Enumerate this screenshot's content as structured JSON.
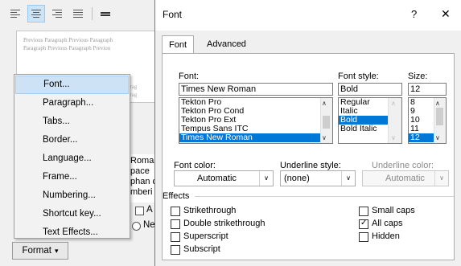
{
  "background_dialog": {
    "preview_text_lines": [
      "Previous Paragraph Previous Paragraph",
      "Paragraph Previous Paragraph Previou"
    ],
    "preview_body_lines": [
      "g Parag",
      "g Parag"
    ],
    "behind_text_lines": [
      "Roman",
      "pace",
      "phan c",
      "mberi"
    ],
    "behind_labels": {
      "a": "A",
      "new": "New"
    },
    "format_button_label": "Format",
    "format_button_arrow": "▾"
  },
  "context_menu": {
    "items": [
      {
        "label": "Font...",
        "highlighted": true
      },
      {
        "label": "Paragraph...",
        "highlighted": false
      },
      {
        "label": "Tabs...",
        "highlighted": false
      },
      {
        "label": "Border...",
        "highlighted": false
      },
      {
        "label": "Language...",
        "highlighted": false
      },
      {
        "label": "Frame...",
        "highlighted": false
      },
      {
        "label": "Numbering...",
        "highlighted": false
      },
      {
        "label": "Shortcut key...",
        "highlighted": false
      },
      {
        "label": "Text Effects...",
        "highlighted": false
      }
    ]
  },
  "font_dialog": {
    "title": "Font",
    "help_glyph": "?",
    "close_glyph": "✕",
    "tabs": [
      {
        "label": "Font",
        "active": true
      },
      {
        "label": "Advanced",
        "active": false
      }
    ],
    "font": {
      "label": "Font:",
      "value": "Times New Roman",
      "list": [
        "Tekton Pro",
        "Tekton Pro Cond",
        "Tekton Pro Ext",
        "Tempus Sans ITC",
        "Times New Roman"
      ],
      "selected_index": 4
    },
    "font_style": {
      "label": "Font style:",
      "value": "Bold",
      "list": [
        "Regular",
        "Italic",
        "Bold",
        "Bold Italic"
      ],
      "selected_index": 2
    },
    "size": {
      "label": "Size:",
      "value": "12",
      "list": [
        "8",
        "9",
        "10",
        "11",
        "12"
      ],
      "selected_index": 4
    },
    "font_color": {
      "label": "Font color:",
      "value": "Automatic"
    },
    "underline_style": {
      "label": "Underline style:",
      "value": "(none)"
    },
    "underline_color": {
      "label": "Underline color:",
      "value": "Automatic"
    },
    "effects": {
      "label": "Effects",
      "left": [
        {
          "label": "Strikethrough",
          "checked": false
        },
        {
          "label": "Double strikethrough",
          "checked": false
        },
        {
          "label": "Superscript",
          "checked": false
        },
        {
          "label": "Subscript",
          "checked": false
        }
      ],
      "right": [
        {
          "label": "Small caps",
          "checked": false
        },
        {
          "label": "All caps",
          "checked": true
        },
        {
          "label": "Hidden",
          "checked": false
        }
      ]
    }
  },
  "icons": {
    "align_left": "align-left-icon",
    "align_center": "align-center-icon",
    "align_right": "align-right-icon",
    "justify": "justify-icon",
    "line_spacing": "line-spacing-icon",
    "checkmark": "✓",
    "arrow_up": "∧",
    "arrow_down": "∨"
  },
  "colors": {
    "selection": "#0078d7",
    "menu_highlight": "#cde2f5",
    "dialog_bg": "#f0f0f0"
  }
}
